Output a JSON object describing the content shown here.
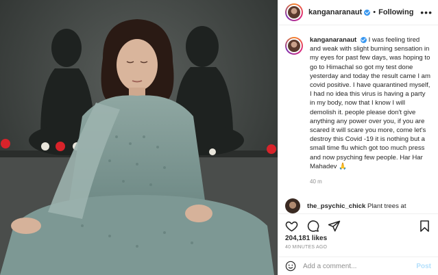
{
  "header": {
    "username": "kanganaranaut",
    "separator": "•",
    "following_label": "Following",
    "more_icon": "more-horizontal-icon"
  },
  "caption": {
    "username": "kanganaranaut",
    "text": "I was feeling tired and weak with slight burning sensation in my eyes for past few days, was hoping to go to Himachal so got my test done yesterday and today the result came I am covid positive. I have quarantined myself, I had no idea this virus is having a party in my body, now that I know I will demolish it. people please don't give anything any power over you, if you are scared it will scare you more, come let's destroy this Covid -19 it is nothing but a small time flu which got too much press and now psyching few people. Har Har Mahadev 🙏",
    "time": "40 m"
  },
  "second_comment": {
    "username": "the_psychic_chick",
    "text": "Plant trees at"
  },
  "actions": {
    "icons": [
      "heart-icon",
      "comment-icon",
      "share-icon",
      "bookmark-icon"
    ],
    "likes": "204,181 likes",
    "timestamp": "40 MINUTES AGO"
  },
  "comment_box": {
    "placeholder": "Add a comment...",
    "post_label": "Post",
    "emoji_icon": "smiley-icon"
  },
  "colors": {
    "verified_blue": "#3897f0",
    "post_button_disabled": "#b2dffc",
    "muted_text": "#8e8e8e",
    "text": "#262626"
  }
}
